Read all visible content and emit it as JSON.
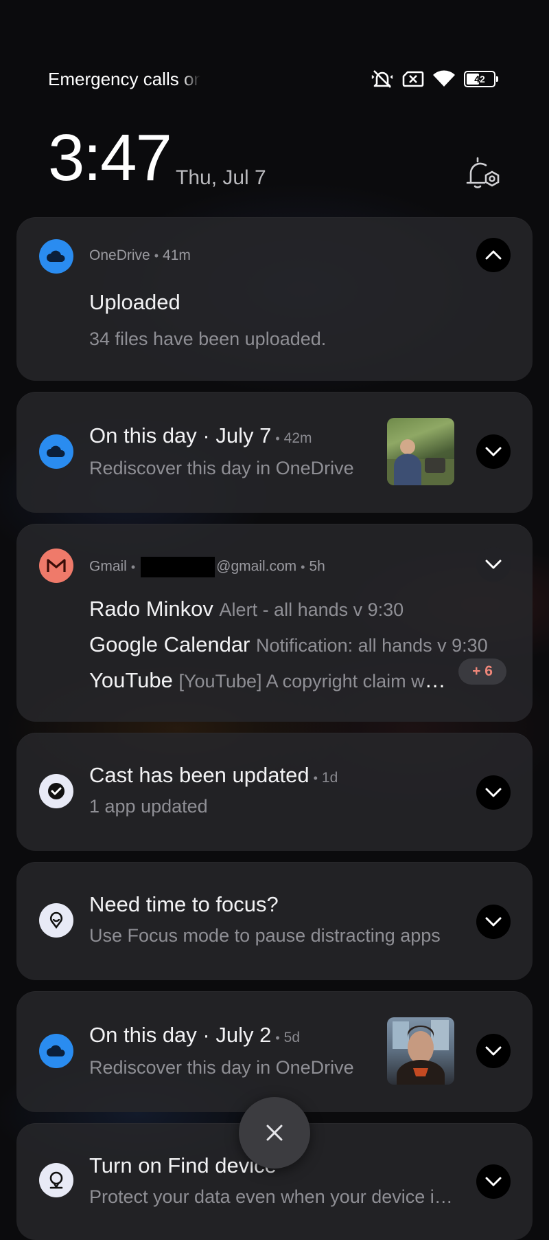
{
  "status_bar": {
    "carrier_text": "Emergency calls only",
    "battery_level": "42",
    "icons": [
      "vibrate-off-icon",
      "no-sim-icon",
      "wifi-icon",
      "battery-icon"
    ]
  },
  "lock": {
    "time": "3:47",
    "date": "Thu, Jul 7"
  },
  "notifications": [
    {
      "app": "OneDrive",
      "time": "41m",
      "title": "Uploaded",
      "text": "34 files have been uploaded.",
      "expanded": true
    },
    {
      "app": "OneDrive",
      "title": "On this day · July 7",
      "time": "42m",
      "text": "Rediscover this day in OneDrive"
    },
    {
      "app": "Gmail",
      "account_suffix": "@gmail.com",
      "time": "5h",
      "messages": [
        {
          "from": "Rado Minkov",
          "snippet": "Alert - all hands v 9:30"
        },
        {
          "from": "Google Calendar",
          "snippet": "Notification: all hands v 9:30"
        },
        {
          "from": "YouTube",
          "snippet": "[YouTube] A copyright claim was made"
        }
      ],
      "more_count": "+ 6"
    },
    {
      "title": "Cast has been updated",
      "time": "1d",
      "text": "1 app updated"
    },
    {
      "title": "Need time to focus?",
      "text": "Use Focus mode to pause distracting apps"
    },
    {
      "app": "OneDrive",
      "title": "On this day · July 2",
      "time": "5d",
      "text": "Rediscover this day in OneDrive"
    },
    {
      "title": "Turn on Find device",
      "text": "Protect your data even when your device is lost"
    }
  ],
  "colors": {
    "onedrive": "#2a8cf0",
    "gmail": "#ef7a6a",
    "badge_text": "#f0877a"
  }
}
